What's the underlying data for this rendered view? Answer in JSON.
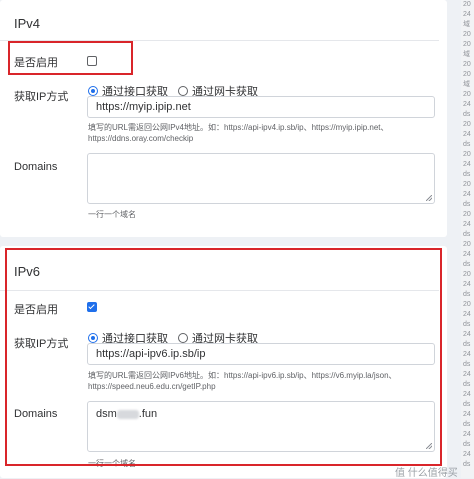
{
  "ipv4": {
    "title": "IPv4",
    "enable_label": "是否启用",
    "enabled": false,
    "method_label": "获取IP方式",
    "radio_options": [
      "通过接口获取",
      "通过网卡获取"
    ],
    "selected_option": 0,
    "url_value": "https://myip.ipip.net",
    "hint_lines": [
      "填写的URL需返回公网IPv4地址。如：https://api-ipv4.ip.sb/ip、https://myip.ipip.net、",
      "https://ddns.oray.com/checkip"
    ],
    "domains_label": "Domains",
    "domains_value": "",
    "domains_hint": "一行一个域名"
  },
  "ipv6": {
    "title": "IPv6",
    "enable_label": "是否启用",
    "enabled": true,
    "method_label": "获取IP方式",
    "radio_options": [
      "通过接口获取",
      "通过网卡获取"
    ],
    "selected_option": 0,
    "url_value": "https://api-ipv6.ip.sb/ip",
    "hint_lines": [
      "填写的URL需返回公网IPv6地址。如：https://api-ipv6.ip.sb/ip、https://v6.myip.la/json、",
      "https://speed.neu6.edu.cn/getIP.php"
    ],
    "domains_label": "Domains",
    "domains_prefix": "dsm",
    "domains_suffix": ".fun",
    "domains_hint": "一行一个域名"
  },
  "side_log": [
    "20",
    "24",
    "域",
    "20",
    "20",
    "域",
    "20",
    "20",
    "域",
    "20",
    "24",
    "ds",
    "20",
    "24",
    "ds",
    "20",
    "24",
    "ds",
    "20",
    "24",
    "ds",
    "20",
    "24",
    "ds",
    "20",
    "24",
    "ds",
    "20",
    "24",
    "ds",
    "20",
    "24",
    "ds",
    "24",
    "ds",
    "24",
    "ds",
    "24",
    "ds",
    "24",
    "ds",
    "24",
    "ds",
    "24",
    "ds",
    "24",
    "ds"
  ],
  "watermark": "值 什么值得买"
}
